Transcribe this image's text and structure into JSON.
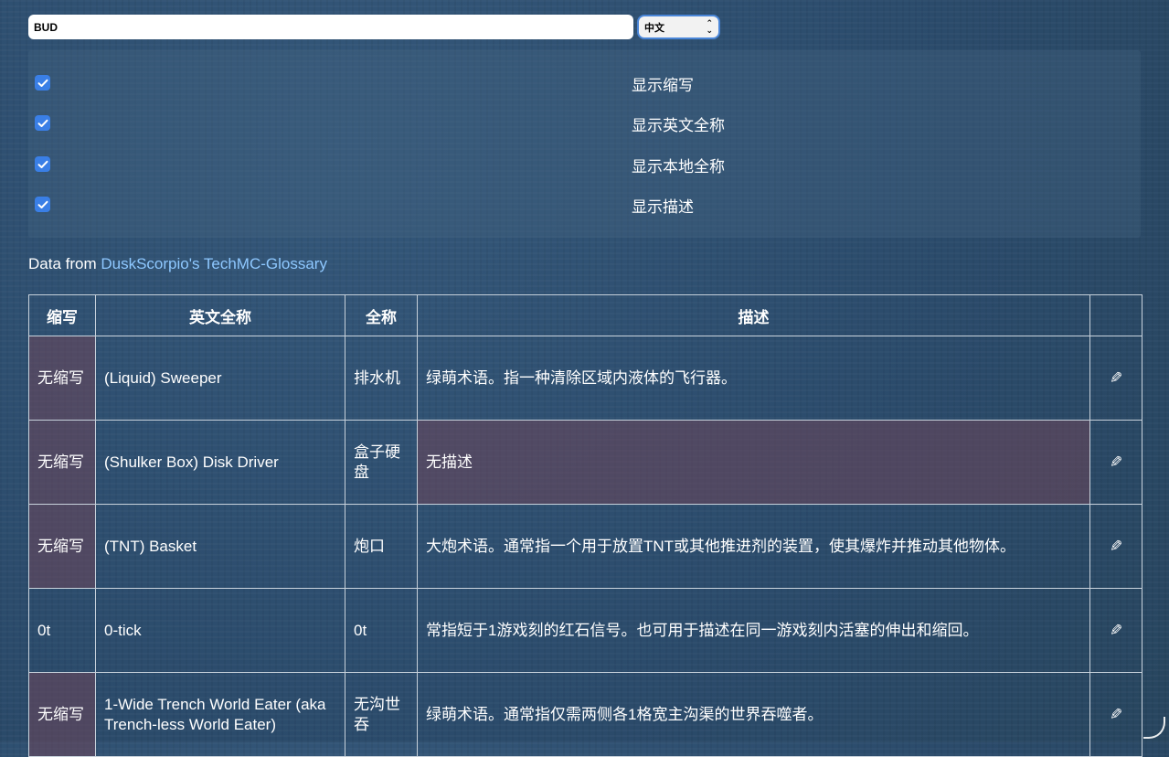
{
  "search": {
    "value": "BUD"
  },
  "language": {
    "selected": "中文"
  },
  "options": [
    {
      "label": "显示缩写",
      "checked": true
    },
    {
      "label": "显示英文全称",
      "checked": true
    },
    {
      "label": "显示本地全称",
      "checked": true
    },
    {
      "label": "显示描述",
      "checked": true
    }
  ],
  "source": {
    "prefix": "Data from ",
    "link_text": "DuskScorpio's TechMC-Glossary"
  },
  "table": {
    "headers": [
      "缩写",
      "英文全称",
      "全称",
      "描述",
      ""
    ],
    "edit_glyph": "✎",
    "rows": [
      {
        "abbr": "无缩写",
        "english": "(Liquid) Sweeper",
        "full": "排水机",
        "desc": "绿萌术语。指一种清除区域内液体的飞行器。",
        "abbr_missing": true,
        "desc_missing": false
      },
      {
        "abbr": "无缩写",
        "english": "(Shulker Box) Disk Driver",
        "full": "盒子硬盘",
        "desc": "无描述",
        "abbr_missing": true,
        "desc_missing": true
      },
      {
        "abbr": "无缩写",
        "english": "(TNT) Basket",
        "full": "炮口",
        "desc": "大炮术语。通常指一个用于放置TNT或其他推进剂的装置，使其爆炸并推动其他物体。",
        "abbr_missing": true,
        "desc_missing": false
      },
      {
        "abbr": "0t",
        "english": "0-tick",
        "full": "0t",
        "desc": "常指短于1游戏刻的红石信号。也可用于描述在同一游戏刻内活塞的伸出和缩回。",
        "abbr_missing": false,
        "desc_missing": false
      },
      {
        "abbr": "无缩写",
        "english": "1-Wide Trench World Eater (aka Trench-less World Eater)",
        "full": "无沟世吞",
        "desc": "绿萌术语。通常指仅需两侧各1格宽主沟渠的世界吞噬者。",
        "abbr_missing": true,
        "desc_missing": false
      }
    ]
  },
  "colors": {
    "background": "#2c4d6e",
    "link": "#8ec8ff",
    "checkbox": "#3a7fe6",
    "missing_cell": "#6e465a"
  }
}
